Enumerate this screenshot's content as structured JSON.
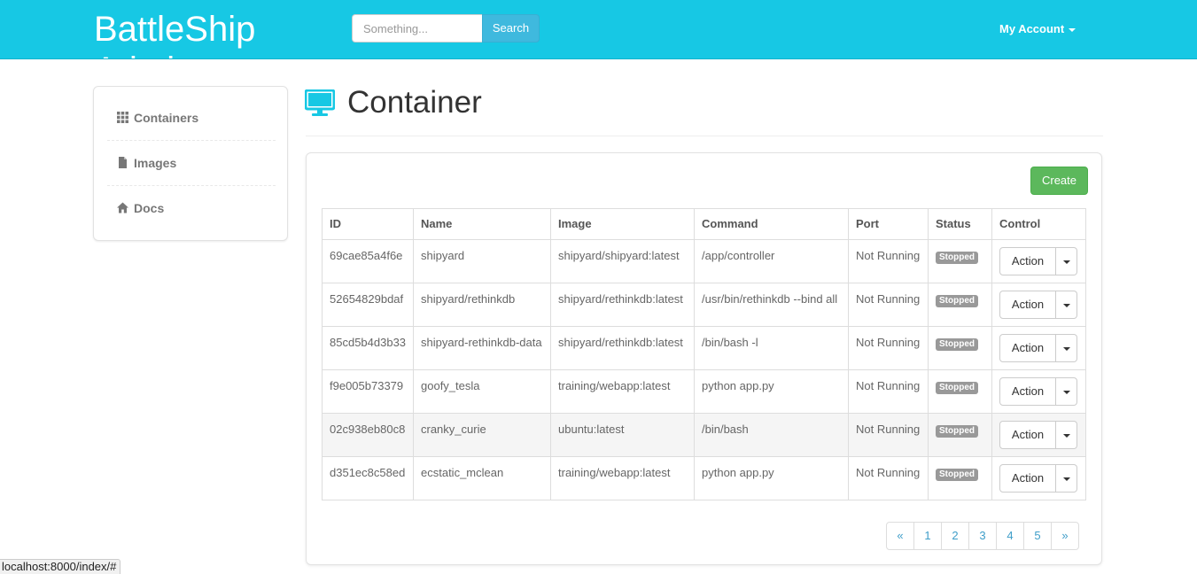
{
  "navbar": {
    "brand_line1": "BattleShip",
    "brand_line2": "Admin",
    "search_placeholder": "Something...",
    "search_button": "Search",
    "account_label": "My Account",
    "bg_color": "#17c8e4"
  },
  "sidebar": {
    "items": [
      {
        "label": "Containers",
        "icon": "grid-icon"
      },
      {
        "label": "Images",
        "icon": "file-icon"
      },
      {
        "label": "Docs",
        "icon": "home-icon"
      }
    ]
  },
  "page": {
    "title": "Container",
    "title_icon": "monitor-icon"
  },
  "panel": {
    "create_button": "Create"
  },
  "table": {
    "headers": [
      "ID",
      "Name",
      "Image",
      "Command",
      "Port",
      "Status",
      "Control"
    ],
    "rows": [
      {
        "id": "69cae85a4f6e",
        "name": "shipyard",
        "image": "shipyard/shipyard:latest",
        "command": "/app/controller",
        "port": "Not Running",
        "status": "Stopped",
        "action": "Action"
      },
      {
        "id": "52654829bdaf",
        "name": "shipyard/rethinkdb",
        "image": "shipyard/rethinkdb:latest",
        "command": "/usr/bin/rethinkdb --bind all",
        "port": "Not Running",
        "status": "Stopped",
        "action": "Action"
      },
      {
        "id": "85cd5b4d3b33",
        "name": "shipyard-rethinkdb-data",
        "image": "shipyard/rethinkdb:latest",
        "command": "/bin/bash -l",
        "port": "Not Running",
        "status": "Stopped",
        "action": "Action"
      },
      {
        "id": "f9e005b73379",
        "name": "goofy_tesla",
        "image": "training/webapp:latest",
        "command": "python app.py",
        "port": "Not Running",
        "status": "Stopped",
        "action": "Action"
      },
      {
        "id": "02c938eb80c8",
        "name": "cranky_curie",
        "image": "ubuntu:latest",
        "command": "/bin/bash",
        "port": "Not Running",
        "status": "Stopped",
        "action": "Action"
      },
      {
        "id": "d351ec8c58ed",
        "name": "ecstatic_mclean",
        "image": "training/webapp:latest",
        "command": "python app.py",
        "port": "Not Running",
        "status": "Stopped",
        "action": "Action"
      }
    ]
  },
  "pagination": {
    "prev": "«",
    "pages": [
      "1",
      "2",
      "3",
      "4",
      "5"
    ],
    "next": "»"
  },
  "statusbar": {
    "url": "localhost:8000/index/#"
  },
  "colors": {
    "accent": "#17c8e4",
    "create": "#5cb85c",
    "badge": "#999999",
    "link": "#3f9ec9"
  }
}
